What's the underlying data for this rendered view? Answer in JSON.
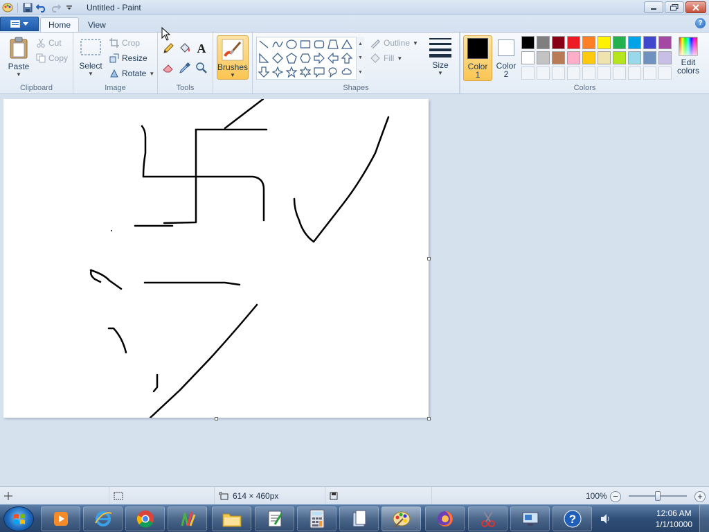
{
  "window": {
    "title": "Untitled - Paint"
  },
  "tabs": [
    {
      "label": "Home"
    },
    {
      "label": "View"
    }
  ],
  "clipboard": {
    "paste_label": "Paste",
    "cut_label": "Cut",
    "copy_label": "Copy",
    "group_label": "Clipboard"
  },
  "image": {
    "select_label": "Select",
    "crop_label": "Crop",
    "resize_label": "Resize",
    "rotate_label": "Rotate",
    "group_label": "Image"
  },
  "tools": {
    "group_label": "Tools",
    "text_tool_glyph": "A"
  },
  "brushes": {
    "label": "Brushes"
  },
  "shapes": {
    "outline_label": "Outline",
    "fill_label": "Fill",
    "group_label": "Shapes"
  },
  "size": {
    "label": "Size"
  },
  "colors": {
    "color1_label": "Color",
    "color1_num": "1",
    "color2_label": "Color",
    "color2_num": "2",
    "color1_value": "#000000",
    "color2_value": "#ffffff",
    "edit_label_line1": "Edit",
    "edit_label_line2": "colors",
    "group_label": "Colors",
    "palette_row1": [
      "#000000",
      "#7f7f7f",
      "#880015",
      "#ed1c24",
      "#ff7f27",
      "#fff200",
      "#22b14c",
      "#00a2e8",
      "#3f48cc",
      "#a349a4"
    ],
    "palette_row2": [
      "#ffffff",
      "#c3c3c3",
      "#b97a57",
      "#ffaec9",
      "#ffc90e",
      "#efe4b0",
      "#b5e61d",
      "#99d9ea",
      "#7092be",
      "#c8bfe7"
    ]
  },
  "status": {
    "image_size": "614 × 460px",
    "zoom": "100%"
  },
  "taskbar": {
    "time": "12:06 AM",
    "date": "1/1/10000",
    "apps": [
      "media-player",
      "internet-explorer",
      "chrome",
      "paint-tools",
      "file-explorer",
      "notepad-app",
      "calculator",
      "files-app",
      "paint",
      "firefox",
      "snipping-tool",
      "remote-desktop",
      "help"
    ]
  }
}
